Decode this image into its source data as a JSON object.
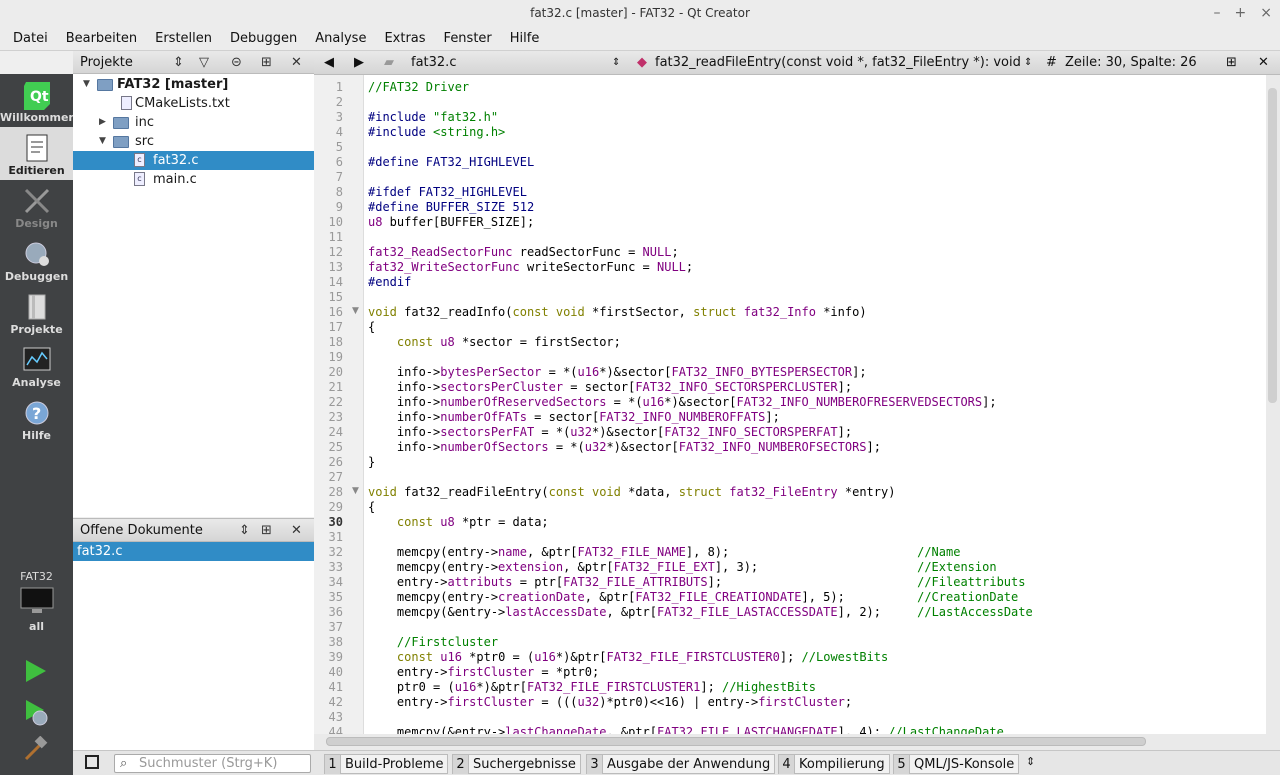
{
  "window": {
    "title": "fat32.c [master] - FAT32 - Qt Creator",
    "min": "–",
    "max": "+",
    "close": "×"
  },
  "menu": [
    "Datei",
    "Bearbeiten",
    "Erstellen",
    "Debuggen",
    "Analyse",
    "Extras",
    "Fenster",
    "Hilfe"
  ],
  "modes": [
    {
      "label": "Willkommen",
      "icon": "qt-logo-icon"
    },
    {
      "label": "Editieren",
      "icon": "edit-document-icon"
    },
    {
      "label": "Design",
      "icon": "design-icon"
    },
    {
      "label": "Debuggen",
      "icon": "debug-icon"
    },
    {
      "label": "Projekte",
      "icon": "projects-icon"
    },
    {
      "label": "Analyse",
      "icon": "analyze-icon"
    },
    {
      "label": "Hilfe",
      "icon": "help-icon"
    }
  ],
  "kit": {
    "project": "FAT32",
    "config": "all"
  },
  "projects": {
    "header": "Projekte",
    "tree": [
      {
        "label": "FAT32 [master]",
        "type": "root"
      },
      {
        "label": "CMakeLists.txt",
        "type": "file"
      },
      {
        "label": "inc",
        "type": "folder"
      },
      {
        "label": "src",
        "type": "folder"
      },
      {
        "label": "fat32.c",
        "type": "cfile"
      },
      {
        "label": "main.c",
        "type": "cfile"
      }
    ]
  },
  "open_docs": {
    "header": "Offene Dokumente",
    "items": [
      "fat32.c"
    ]
  },
  "editor": {
    "file": "fat32.c",
    "symbol": "fat32_readFileEntry(const void *, fat32_FileEntry *): void",
    "hash": "#",
    "position": "Zeile: 30, Spalte: 26",
    "current_line": 30,
    "lines": [
      "//FAT32 Driver",
      "",
      "#include \"fat32.h\"",
      "#include <string.h>",
      "",
      "#define FAT32_HIGHLEVEL",
      "",
      "#ifdef FAT32_HIGHLEVEL",
      "#define BUFFER_SIZE 512",
      "u8 buffer[BUFFER_SIZE];",
      "",
      "fat32_ReadSectorFunc readSectorFunc = NULL;",
      "fat32_WriteSectorFunc writeSectorFunc = NULL;",
      "#endif",
      "",
      "void fat32_readInfo(const void *firstSector, struct fat32_Info *info)",
      "{",
      "    const u8 *sector = firstSector;",
      "",
      "    info->bytesPerSector = *(u16*)&sector[FAT32_INFO_BYTESPERSECTOR];",
      "    info->sectorsPerCluster = sector[FAT32_INFO_SECTORSPERCLUSTER];",
      "    info->numberOfReservedSectors = *(u16*)&sector[FAT32_INFO_NUMBEROFRESERVEDSECTORS];",
      "    info->numberOfFATs = sector[FAT32_INFO_NUMBEROFFATS];",
      "    info->sectorsPerFAT = *(u32*)&sector[FAT32_INFO_SECTORSPERFAT];",
      "    info->numberOfSectors = *(u32*)&sector[FAT32_INFO_NUMBEROFSECTORS];",
      "}",
      "",
      "void fat32_readFileEntry(const void *data, struct fat32_FileEntry *entry)",
      "{",
      "    const u8 *ptr = data;",
      "",
      "    memcpy(entry->name, &ptr[FAT32_FILE_NAME], 8);                          //Name",
      "    memcpy(entry->extension, &ptr[FAT32_FILE_EXT], 3);                      //Extension",
      "    entry->attributs = ptr[FAT32_FILE_ATTRIBUTS];                           //Fileattributs",
      "    memcpy(entry->creationDate, &ptr[FAT32_FILE_CREATIONDATE], 5);          //CreationDate",
      "    memcpy(&entry->lastAccessDate, &ptr[FAT32_FILE_LASTACCESSDATE], 2);     //LastAccessDate",
      "",
      "    //Firstcluster",
      "    const u16 *ptr0 = (u16*)&ptr[FAT32_FILE_FIRSTCLUSTER0]; //LowestBits",
      "    entry->firstCluster = *ptr0;",
      "    ptr0 = (u16*)&ptr[FAT32_FILE_FIRSTCLUSTER1]; //HighestBits",
      "    entry->firstCluster = (((u32)*ptr0)<<16) | entry->firstCluster;",
      "",
      "    memcpy(&entry->lastChangeDate, &ptr[FAT32_FILE_LASTCHANGEDATE], 4); //LastChangeDate"
    ]
  },
  "status": {
    "search_placeholder": "Suchmuster (Strg+K)",
    "tabs": [
      {
        "num": "1",
        "label": "Build-Probleme"
      },
      {
        "num": "2",
        "label": "Suchergebnisse"
      },
      {
        "num": "3",
        "label": "Ausgabe der Anwendung"
      },
      {
        "num": "4",
        "label": "Kompilierung"
      },
      {
        "num": "5",
        "label": "QML/JS-Konsole"
      }
    ]
  },
  "colors": {
    "accent": "#308cc6",
    "keyword": "#808000",
    "type": "#800080",
    "string": "#008000",
    "comment": "#008000",
    "define": "#000080"
  }
}
